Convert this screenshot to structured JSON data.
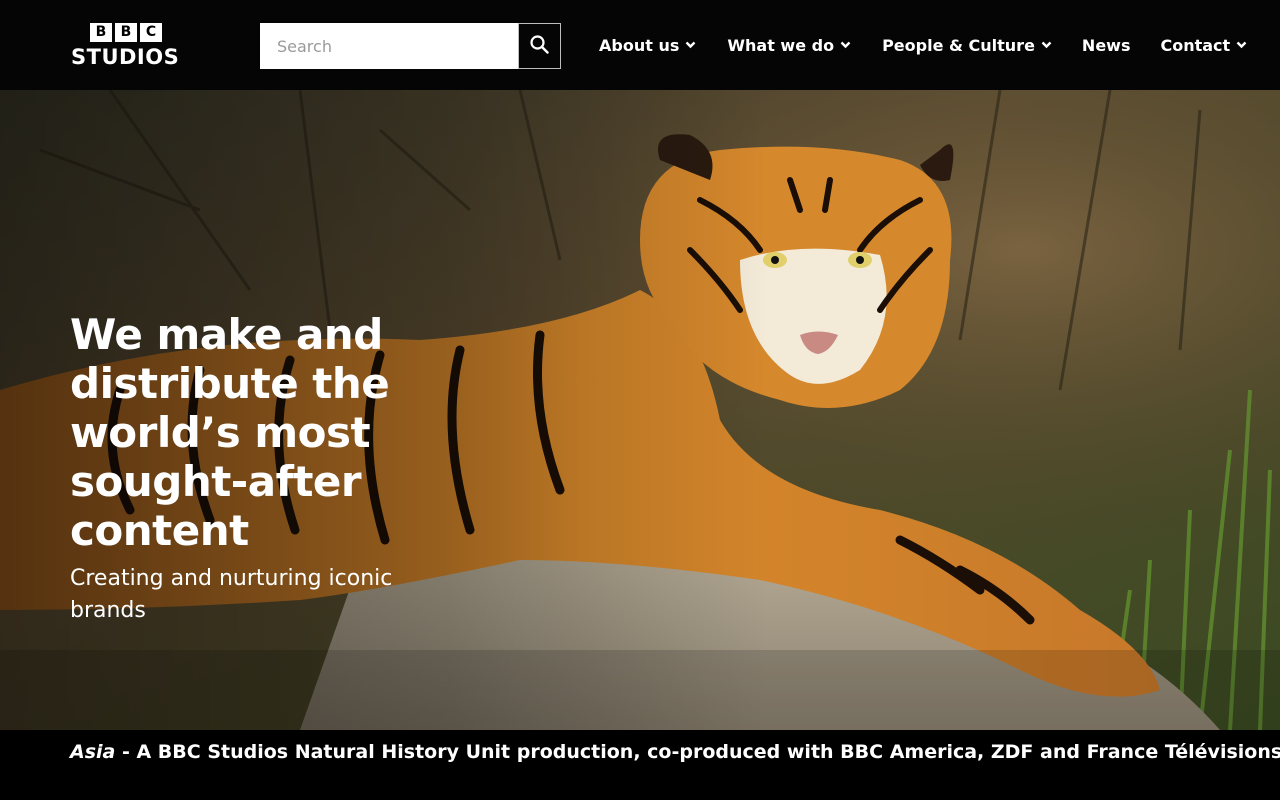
{
  "header": {
    "logo": {
      "letters": [
        "B",
        "B",
        "C"
      ],
      "word": "STUDIOS"
    },
    "search": {
      "placeholder": "Search",
      "value": "",
      "icon": "search-icon"
    },
    "nav": [
      {
        "label": "About us",
        "has_dropdown": true
      },
      {
        "label": "What we do",
        "has_dropdown": true
      },
      {
        "label": "People & Culture",
        "has_dropdown": true
      },
      {
        "label": "News",
        "has_dropdown": false
      },
      {
        "label": "Contact",
        "has_dropdown": true
      }
    ]
  },
  "hero": {
    "title": "We make and distribute the world’s most sought-after content",
    "subtitle": "Creating and nurturing iconic brands"
  },
  "caption": {
    "show_title": "Asia",
    "text": " - A BBC Studios Natural History Unit production, co-produced with BBC America, ZDF and France Télévisions"
  },
  "colors": {
    "header_bg": "#050505",
    "text": "#ffffff",
    "caption_bg": "#000000"
  }
}
